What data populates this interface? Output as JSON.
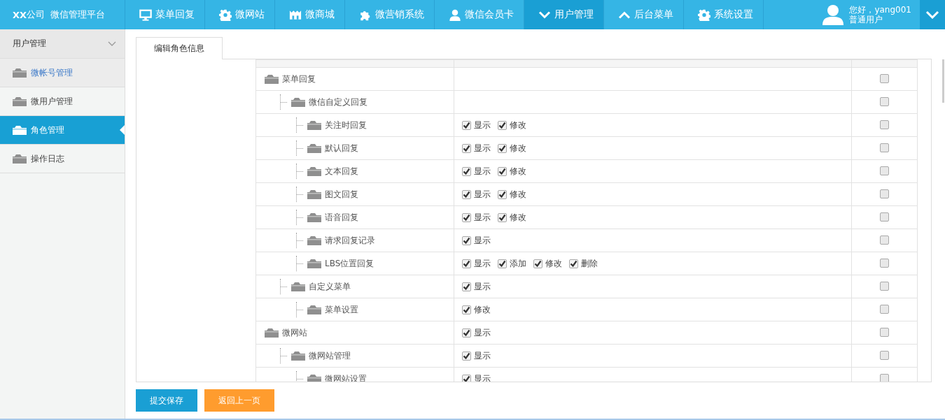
{
  "brand": {
    "strong": "XX",
    "text": "公司  微信管理平台"
  },
  "nav": [
    {
      "label": "菜单回复",
      "selected": false
    },
    {
      "label": "微网站",
      "selected": false
    },
    {
      "label": "微商城",
      "selected": false
    },
    {
      "label": "微营销系统",
      "selected": false
    },
    {
      "label": "微信会员卡",
      "selected": false
    },
    {
      "label": "用户管理",
      "selected": true
    },
    {
      "label": "后台菜单",
      "selected": false
    },
    {
      "label": "系统设置",
      "selected": false
    }
  ],
  "user": {
    "greeting": "您好，yang001",
    "role": "普通用户"
  },
  "sidebar": {
    "title": "用户管理",
    "expanded": true,
    "items": [
      {
        "label": "微帐号管理",
        "selected": false,
        "hovered": true
      },
      {
        "label": "微用户管理",
        "selected": false,
        "hovered": false
      },
      {
        "label": "角色管理",
        "selected": true,
        "hovered": false
      },
      {
        "label": "操作日志",
        "selected": false,
        "hovered": false
      }
    ]
  },
  "tabs": [
    {
      "label": "编辑角色信息",
      "selected": true
    }
  ],
  "tree": [
    {
      "name": "菜单回复",
      "checked": false,
      "children": [
        {
          "name": "微信自定义回复",
          "checked": false,
          "children": [
            {
              "name": "关注时回复",
              "perms": [
                {
                  "label": "显示",
                  "checked": true
                },
                {
                  "label": "修改",
                  "checked": true
                }
              ],
              "checked": false
            },
            {
              "name": "默认回复",
              "perms": [
                {
                  "label": "显示",
                  "checked": true
                },
                {
                  "label": "修改",
                  "checked": true
                }
              ],
              "checked": false
            },
            {
              "name": "文本回复",
              "perms": [
                {
                  "label": "显示",
                  "checked": true
                },
                {
                  "label": "修改",
                  "checked": true
                }
              ],
              "checked": false
            },
            {
              "name": "图文回复",
              "perms": [
                {
                  "label": "显示",
                  "checked": true
                },
                {
                  "label": "修改",
                  "checked": true
                }
              ],
              "checked": false
            },
            {
              "name": "语音回复",
              "perms": [
                {
                  "label": "显示",
                  "checked": true
                },
                {
                  "label": "修改",
                  "checked": true
                }
              ],
              "checked": false
            },
            {
              "name": "请求回复记录",
              "perms": [
                {
                  "label": "显示",
                  "checked": true
                }
              ],
              "checked": false
            },
            {
              "name": "LBS位置回复",
              "perms": [
                {
                  "label": "显示",
                  "checked": true
                },
                {
                  "label": "添加",
                  "checked": true
                },
                {
                  "label": "修改",
                  "checked": true
                },
                {
                  "label": "删除",
                  "checked": true
                }
              ],
              "checked": false
            }
          ]
        },
        {
          "name": "自定义菜单",
          "perms": [
            {
              "label": "显示",
              "checked": true
            }
          ],
          "checked": false,
          "children": [
            {
              "name": "菜单设置",
              "perms": [
                {
                  "label": "修改",
                  "checked": true
                }
              ],
              "checked": false
            }
          ]
        }
      ]
    },
    {
      "name": "微网站",
      "perms": [
        {
          "label": "显示",
          "checked": true
        }
      ],
      "checked": false,
      "children": [
        {
          "name": "微网站管理",
          "perms": [
            {
              "label": "显示",
              "checked": true
            }
          ],
          "checked": false,
          "children": [
            {
              "name": "微网站设置",
              "perms": [
                {
                  "label": "显示",
                  "checked": true
                }
              ],
              "checked": false
            }
          ]
        }
      ]
    }
  ],
  "buttons": [
    {
      "label": "提交保存",
      "kind": "primary"
    },
    {
      "label": "返回上一页",
      "kind": "secondary"
    }
  ]
}
